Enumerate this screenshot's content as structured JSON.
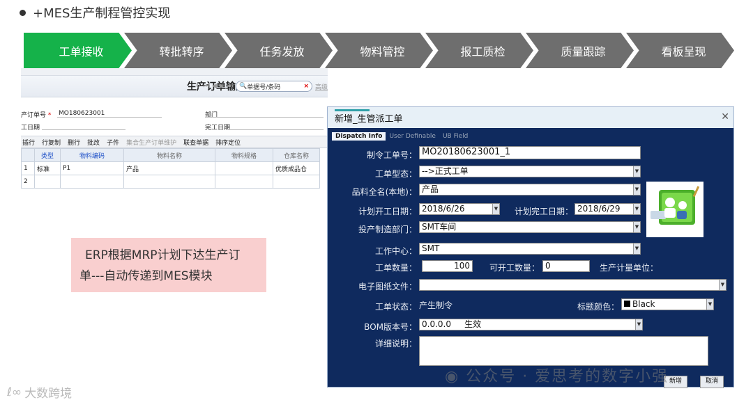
{
  "slide": {
    "title": "+MES生产制程管控实现"
  },
  "flow_steps": [
    {
      "label": "工单接收",
      "color": "#15b24a"
    },
    {
      "label": "转批转序",
      "color": "#6e6e6e"
    },
    {
      "label": "任务发放",
      "color": "#6e6e6e"
    },
    {
      "label": "物料管控",
      "color": "#6e6e6e"
    },
    {
      "label": "报工质检",
      "color": "#6e6e6e"
    },
    {
      "label": "质量跟踪",
      "color": "#6e6e6e"
    },
    {
      "label": "看板呈现",
      "color": "#6e6e6e"
    }
  ],
  "erp": {
    "title": "生产订单输入",
    "search_placeholder": "单据号/条码",
    "nav_text": "高级",
    "fields": {
      "order_no_label": "产订单号",
      "order_no_value": "MO180623001",
      "dept_label": "部门",
      "start_label": "工日期",
      "finish_label": "完工日期"
    },
    "grid_toolbar": [
      "插行",
      "行复制",
      "删行",
      "批改",
      "子件",
      "集合生产订单维护",
      "联查单据",
      "排序定位"
    ],
    "columns": [
      "类型",
      "物料编码",
      "物料名称",
      "物料规格",
      "仓库名称"
    ],
    "rows": [
      {
        "num": "1",
        "cells": [
          "标准",
          "P1",
          "产品",
          "",
          "优质成品仓"
        ]
      },
      {
        "num": "2",
        "cells": [
          "",
          "",
          "",
          "",
          ""
        ]
      }
    ]
  },
  "note": {
    "line1": "ERP根据MRP计划下达生产订",
    "line2": "单---自动传递到MES模块"
  },
  "dialog": {
    "title": "新增_生管派工单",
    "tabs": [
      "Dispatch Info",
      "User Definable",
      "UB Field"
    ],
    "work_order_no_label": "制令工单号：",
    "work_order_no_value": "MO20180623001_1",
    "type_label": "工单型态：",
    "type_value": "-->正式工单",
    "item_label": "品料全名(本地)：",
    "item_value": "产品",
    "plan_start_label": "计划开工日期：",
    "plan_start_value": "2018/6/26",
    "plan_finish_label": "计划完工日期：",
    "plan_finish_value": "2018/6/29",
    "dept_label": "投产制造部门：",
    "dept_value": "SMT车间",
    "work_center_label": "工作中心：",
    "work_center_value": "SMT",
    "qty_label": "工单数量：",
    "qty_value": "100",
    "open_qty_label": "可开工数量：",
    "open_qty_value": "0",
    "unit_label": "生产计量单位：",
    "drawing_label": "电子图纸文件：",
    "status_label": "工单状态：",
    "status_value": "产生制令",
    "color_label": "标题颜色：",
    "color_value": "Black",
    "bom_label": "BOM版本号：",
    "bom_value": "0.0.0.0",
    "bom_state": "生效",
    "detail_label": "详细说明：",
    "add_button": "新增",
    "cancel_button": "取消"
  },
  "watermark": "公众号 · 爱思考的数字小强",
  "brand": "大数跨境"
}
